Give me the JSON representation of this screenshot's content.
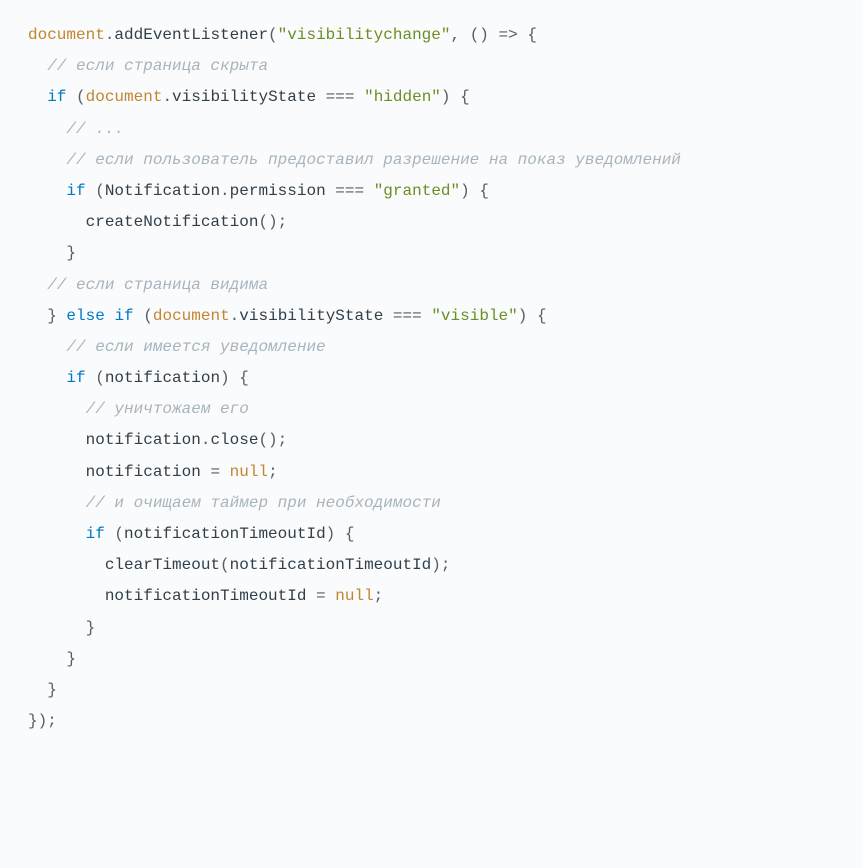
{
  "code": {
    "lines": [
      {
        "indent": 0,
        "tokens": [
          {
            "type": "identifier",
            "text": "document"
          },
          {
            "type": "punct",
            "text": "."
          },
          {
            "type": "text",
            "text": "addEventListener"
          },
          {
            "type": "paren",
            "text": "("
          },
          {
            "type": "string",
            "text": "\"visibilitychange\""
          },
          {
            "type": "punct",
            "text": ", "
          },
          {
            "type": "paren",
            "text": "()"
          },
          {
            "type": "text",
            "text": " "
          },
          {
            "type": "punct",
            "text": "=>"
          },
          {
            "type": "text",
            "text": " "
          },
          {
            "type": "paren",
            "text": "{"
          }
        ]
      },
      {
        "indent": 1,
        "tokens": [
          {
            "type": "comment",
            "text": "// если страница скрыта"
          }
        ]
      },
      {
        "indent": 1,
        "tokens": [
          {
            "type": "kw-blue",
            "text": "if"
          },
          {
            "type": "text",
            "text": " "
          },
          {
            "type": "paren",
            "text": "("
          },
          {
            "type": "identifier",
            "text": "document"
          },
          {
            "type": "punct",
            "text": "."
          },
          {
            "type": "text",
            "text": "visibilityState "
          },
          {
            "type": "punct",
            "text": "==="
          },
          {
            "type": "text",
            "text": " "
          },
          {
            "type": "string",
            "text": "\"hidden\""
          },
          {
            "type": "paren",
            "text": ")"
          },
          {
            "type": "text",
            "text": " "
          },
          {
            "type": "paren",
            "text": "{"
          }
        ]
      },
      {
        "indent": 2,
        "tokens": [
          {
            "type": "comment",
            "text": "// ..."
          }
        ]
      },
      {
        "indent": 0,
        "tokens": [
          {
            "type": "text",
            "text": ""
          }
        ]
      },
      {
        "indent": 2,
        "tokens": [
          {
            "type": "comment",
            "text": "// если пользователь предоставил разрешение на показ уведомлений"
          }
        ]
      },
      {
        "indent": 2,
        "tokens": [
          {
            "type": "kw-blue",
            "text": "if"
          },
          {
            "type": "text",
            "text": " "
          },
          {
            "type": "paren",
            "text": "("
          },
          {
            "type": "text",
            "text": "Notification"
          },
          {
            "type": "punct",
            "text": "."
          },
          {
            "type": "text",
            "text": "permission "
          },
          {
            "type": "punct",
            "text": "==="
          },
          {
            "type": "text",
            "text": " "
          },
          {
            "type": "string",
            "text": "\"granted\""
          },
          {
            "type": "paren",
            "text": ")"
          },
          {
            "type": "text",
            "text": " "
          },
          {
            "type": "paren",
            "text": "{"
          }
        ]
      },
      {
        "indent": 3,
        "tokens": [
          {
            "type": "text",
            "text": "createNotification"
          },
          {
            "type": "paren",
            "text": "()"
          },
          {
            "type": "punct",
            "text": ";"
          }
        ]
      },
      {
        "indent": 2,
        "tokens": [
          {
            "type": "paren",
            "text": "}"
          }
        ]
      },
      {
        "indent": 1,
        "tokens": [
          {
            "type": "comment",
            "text": "// если страница видима"
          }
        ]
      },
      {
        "indent": 1,
        "tokens": [
          {
            "type": "paren",
            "text": "}"
          },
          {
            "type": "text",
            "text": " "
          },
          {
            "type": "kw-blue",
            "text": "else"
          },
          {
            "type": "text",
            "text": " "
          },
          {
            "type": "kw-blue",
            "text": "if"
          },
          {
            "type": "text",
            "text": " "
          },
          {
            "type": "paren",
            "text": "("
          },
          {
            "type": "identifier",
            "text": "document"
          },
          {
            "type": "punct",
            "text": "."
          },
          {
            "type": "text",
            "text": "visibilityState "
          },
          {
            "type": "punct",
            "text": "==="
          },
          {
            "type": "text",
            "text": " "
          },
          {
            "type": "string",
            "text": "\"visible\""
          },
          {
            "type": "paren",
            "text": ")"
          },
          {
            "type": "text",
            "text": " "
          },
          {
            "type": "paren",
            "text": "{"
          }
        ]
      },
      {
        "indent": 2,
        "tokens": [
          {
            "type": "comment",
            "text": "// если имеется уведомление"
          }
        ]
      },
      {
        "indent": 2,
        "tokens": [
          {
            "type": "kw-blue",
            "text": "if"
          },
          {
            "type": "text",
            "text": " "
          },
          {
            "type": "paren",
            "text": "("
          },
          {
            "type": "text",
            "text": "notification"
          },
          {
            "type": "paren",
            "text": ")"
          },
          {
            "type": "text",
            "text": " "
          },
          {
            "type": "paren",
            "text": "{"
          }
        ]
      },
      {
        "indent": 3,
        "tokens": [
          {
            "type": "comment",
            "text": "// уничтожаем его"
          }
        ]
      },
      {
        "indent": 3,
        "tokens": [
          {
            "type": "text",
            "text": "notification"
          },
          {
            "type": "punct",
            "text": "."
          },
          {
            "type": "text",
            "text": "close"
          },
          {
            "type": "paren",
            "text": "()"
          },
          {
            "type": "punct",
            "text": ";"
          }
        ]
      },
      {
        "indent": 3,
        "tokens": [
          {
            "type": "text",
            "text": "notification "
          },
          {
            "type": "punct",
            "text": "="
          },
          {
            "type": "text",
            "text": " "
          },
          {
            "type": "null",
            "text": "null"
          },
          {
            "type": "punct",
            "text": ";"
          }
        ]
      },
      {
        "indent": 3,
        "tokens": [
          {
            "type": "comment",
            "text": "// и очищаем таймер при необходимости"
          }
        ]
      },
      {
        "indent": 3,
        "tokens": [
          {
            "type": "kw-blue",
            "text": "if"
          },
          {
            "type": "text",
            "text": " "
          },
          {
            "type": "paren",
            "text": "("
          },
          {
            "type": "text",
            "text": "notificationTimeoutId"
          },
          {
            "type": "paren",
            "text": ")"
          },
          {
            "type": "text",
            "text": " "
          },
          {
            "type": "paren",
            "text": "{"
          }
        ]
      },
      {
        "indent": 4,
        "tokens": [
          {
            "type": "text",
            "text": "clearTimeout"
          },
          {
            "type": "paren",
            "text": "("
          },
          {
            "type": "text",
            "text": "notificationTimeoutId"
          },
          {
            "type": "paren",
            "text": ")"
          },
          {
            "type": "punct",
            "text": ";"
          }
        ]
      },
      {
        "indent": 4,
        "tokens": [
          {
            "type": "text",
            "text": "notificationTimeoutId "
          },
          {
            "type": "punct",
            "text": "="
          },
          {
            "type": "text",
            "text": " "
          },
          {
            "type": "null",
            "text": "null"
          },
          {
            "type": "punct",
            "text": ";"
          }
        ]
      },
      {
        "indent": 3,
        "tokens": [
          {
            "type": "paren",
            "text": "}"
          }
        ]
      },
      {
        "indent": 2,
        "tokens": [
          {
            "type": "paren",
            "text": "}"
          }
        ]
      },
      {
        "indent": 1,
        "tokens": [
          {
            "type": "paren",
            "text": "}"
          }
        ]
      },
      {
        "indent": 0,
        "tokens": [
          {
            "type": "paren",
            "text": "})"
          },
          {
            "type": "punct",
            "text": ";"
          }
        ]
      }
    ]
  }
}
